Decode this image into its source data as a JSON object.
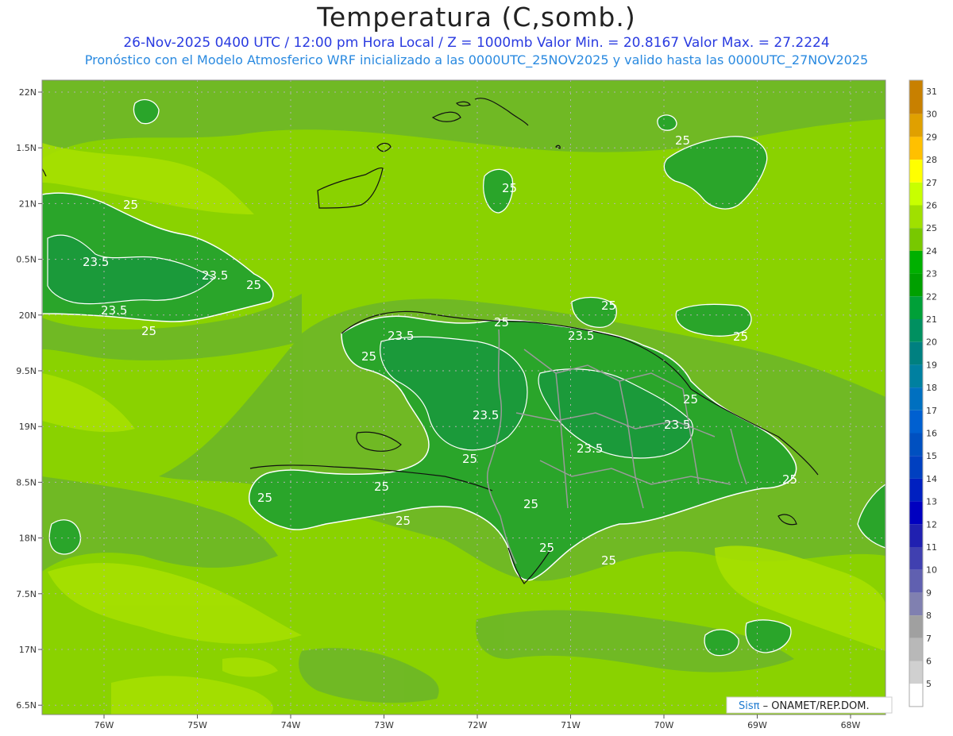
{
  "header": {
    "title": "Temperatura (C,somb.)",
    "line1": "26-Nov-2025 0400 UTC / 12:00 pm Hora Local / Z = 1000mb  Valor Min. = 20.8167  Valor Max. = 27.2224",
    "line2": "Pronóstico con el Modelo Atmosferico WRF inicializado a las 0000UTC_25NOV2025 y valido hasta las  0000UTC_27NOV2025"
  },
  "axes": {
    "lat_labels": [
      "22N",
      "1.5N",
      "21N",
      "0.5N",
      "20N",
      "9.5N",
      "19N",
      "8.5N",
      "18N",
      "7.5N",
      "17N",
      "6.5N"
    ],
    "lon_labels": [
      "76W",
      "75W",
      "74W",
      "73W",
      "72W",
      "71W",
      "70W",
      "69W",
      "68W"
    ]
  },
  "colorbar": {
    "labels": [
      "31",
      "30",
      "29",
      "28",
      "27",
      "26",
      "25",
      "24",
      "23",
      "22",
      "21",
      "20",
      "19",
      "18",
      "17",
      "16",
      "15",
      "14",
      "13",
      "12",
      "11",
      "10",
      "9",
      "8",
      "7",
      "6",
      "5"
    ],
    "colors": [
      "#c88000",
      "#e0a000",
      "#ffc000",
      "#ffff00",
      "#c8ff00",
      "#a0e000",
      "#78c800",
      "#00b000",
      "#00a000",
      "#00a038",
      "#009060",
      "#008080",
      "#0080a0",
      "#0070c0",
      "#0060d0",
      "#0050c0",
      "#0040c0",
      "#0020c0",
      "#0000c0",
      "#2020b0",
      "#4040b0",
      "#6060b0",
      "#8080b0",
      "#a0a0a0",
      "#b8b8b8",
      "#d0d0d0",
      "#ffffff"
    ]
  },
  "contour_labels": {
    "c25": "25",
    "c235": "23.5"
  },
  "colors": {
    "sea_base": "#8ad200",
    "warm": "#a6e000",
    "land": "#2aa52a",
    "land_cool": "#1b9a3a",
    "band": "#6bb52a"
  },
  "footer": {
    "brand": "Sisπ",
    "text": " – ONAMET/REP.DOM."
  }
}
